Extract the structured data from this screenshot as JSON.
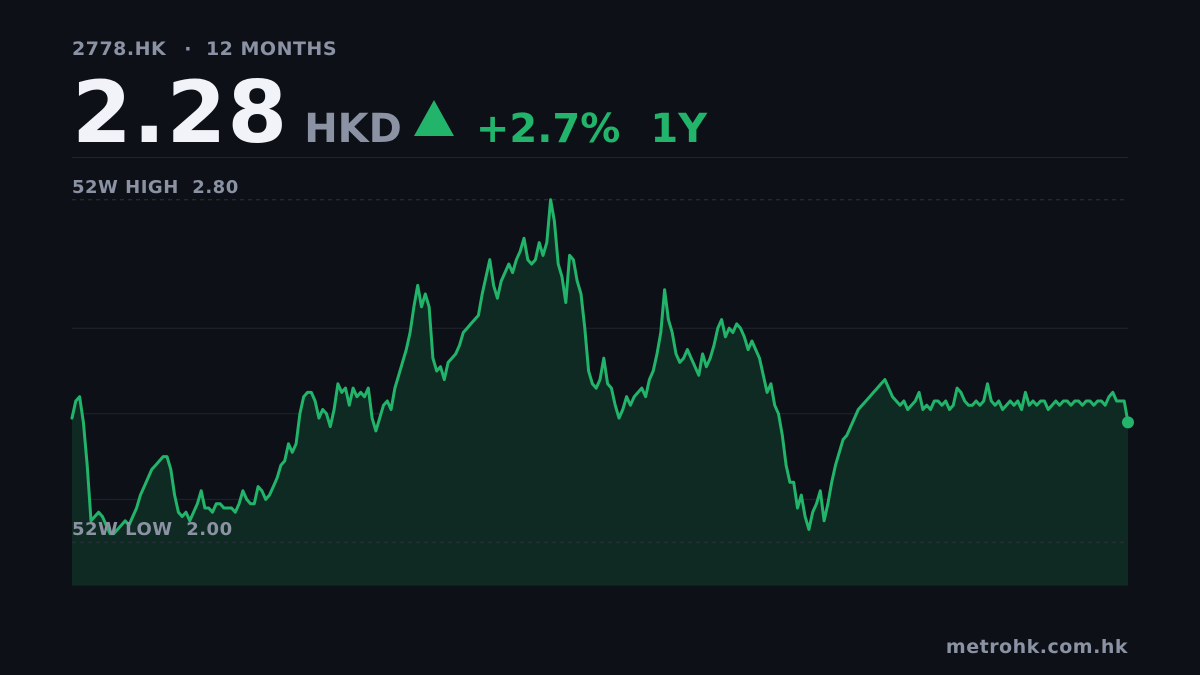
{
  "header": {
    "ticker": "2778.HK",
    "separator": "·",
    "period_label": "12 MONTHS",
    "price": "2.28",
    "currency": "HKD",
    "change": "+2.7%",
    "period": "1Y"
  },
  "footer": {
    "source": "metrohk.com.hk"
  },
  "colors": {
    "background": "#0d1017",
    "line": "#22b46a",
    "area_fill": "#0f2a22",
    "muted_text": "#8a92a3",
    "grid": "#1f242e"
  },
  "chart_data": {
    "type": "area",
    "title": "",
    "xlabel": "",
    "ylabel": "",
    "ylim": [
      1.9,
      2.9
    ],
    "grid": true,
    "reference_lines": [
      {
        "label": "52W HIGH",
        "value_text": "2.80",
        "value": 2.8
      },
      {
        "label": "52W LOW",
        "value_text": "2.00",
        "value": 2.0
      }
    ],
    "series": [
      {
        "values": [
          2.29,
          2.33,
          2.34,
          2.28,
          2.18,
          2.05,
          2.06,
          2.07,
          2.06,
          2.04,
          2.02,
          2.02,
          2.03,
          2.04,
          2.05,
          2.04,
          2.06,
          2.08,
          2.11,
          2.13,
          2.15,
          2.17,
          2.18,
          2.19,
          2.2,
          2.2,
          2.17,
          2.11,
          2.07,
          2.06,
          2.07,
          2.05,
          2.07,
          2.09,
          2.12,
          2.08,
          2.08,
          2.07,
          2.09,
          2.09,
          2.08,
          2.08,
          2.08,
          2.07,
          2.09,
          2.12,
          2.1,
          2.09,
          2.09,
          2.13,
          2.12,
          2.1,
          2.11,
          2.13,
          2.15,
          2.18,
          2.19,
          2.23,
          2.21,
          2.23,
          2.3,
          2.34,
          2.35,
          2.35,
          2.33,
          2.29,
          2.31,
          2.3,
          2.27,
          2.31,
          2.37,
          2.35,
          2.36,
          2.32,
          2.36,
          2.34,
          2.35,
          2.34,
          2.36,
          2.29,
          2.26,
          2.29,
          2.32,
          2.33,
          2.31,
          2.36,
          2.39,
          2.42,
          2.45,
          2.49,
          2.55,
          2.6,
          2.55,
          2.58,
          2.55,
          2.43,
          2.4,
          2.41,
          2.38,
          2.42,
          2.43,
          2.44,
          2.46,
          2.49,
          2.5,
          2.51,
          2.52,
          2.53,
          2.58,
          2.62,
          2.66,
          2.6,
          2.57,
          2.61,
          2.63,
          2.65,
          2.63,
          2.66,
          2.68,
          2.71,
          2.66,
          2.65,
          2.66,
          2.7,
          2.67,
          2.7,
          2.8,
          2.75,
          2.65,
          2.62,
          2.56,
          2.67,
          2.66,
          2.61,
          2.58,
          2.5,
          2.4,
          2.37,
          2.36,
          2.38,
          2.43,
          2.37,
          2.36,
          2.32,
          2.29,
          2.31,
          2.34,
          2.32,
          2.34,
          2.35,
          2.36,
          2.34,
          2.38,
          2.4,
          2.44,
          2.49,
          2.59,
          2.52,
          2.49,
          2.44,
          2.42,
          2.43,
          2.45,
          2.43,
          2.41,
          2.39,
          2.44,
          2.41,
          2.43,
          2.46,
          2.5,
          2.52,
          2.48,
          2.5,
          2.49,
          2.51,
          2.5,
          2.48,
          2.45,
          2.47,
          2.45,
          2.43,
          2.39,
          2.35,
          2.37,
          2.32,
          2.3,
          2.25,
          2.18,
          2.14,
          2.14,
          2.08,
          2.11,
          2.06,
          2.03,
          2.07,
          2.09,
          2.12,
          2.05,
          2.09,
          2.14,
          2.18,
          2.21,
          2.24,
          2.25,
          2.27,
          2.29,
          2.31,
          2.32,
          2.33,
          2.34,
          2.35,
          2.36,
          2.37,
          2.38,
          2.36,
          2.34,
          2.33,
          2.32,
          2.33,
          2.31,
          2.32,
          2.33,
          2.35,
          2.31,
          2.32,
          2.31,
          2.33,
          2.33,
          2.32,
          2.33,
          2.31,
          2.32,
          2.36,
          2.35,
          2.33,
          2.32,
          2.32,
          2.33,
          2.32,
          2.33,
          2.37,
          2.33,
          2.32,
          2.33,
          2.31,
          2.32,
          2.33,
          2.32,
          2.33,
          2.31,
          2.35,
          2.32,
          2.33,
          2.32,
          2.33,
          2.33,
          2.31,
          2.32,
          2.33,
          2.32,
          2.33,
          2.33,
          2.32,
          2.33,
          2.33,
          2.32,
          2.33,
          2.33,
          2.32,
          2.33,
          2.33,
          2.32,
          2.34,
          2.35,
          2.33,
          2.33,
          2.33,
          2.28
        ]
      }
    ]
  }
}
